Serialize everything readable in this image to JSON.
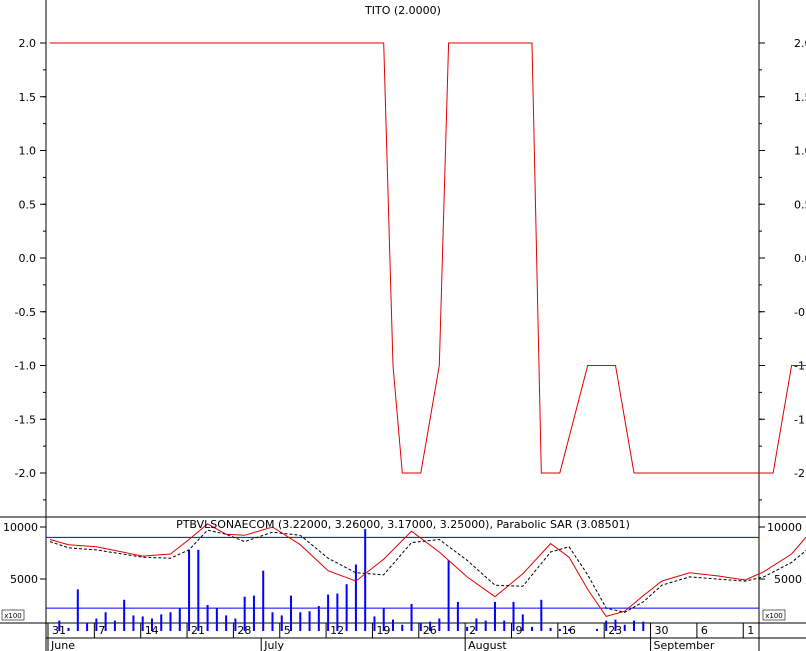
{
  "chart_data": [
    {
      "type": "line",
      "title": "TITO (2.0000)",
      "ylim": [
        -2.5,
        2.25
      ],
      "yticks": [
        "2.0",
        "1.5",
        "1.0",
        "0.5",
        "0.0",
        "-0.5",
        "-1.0",
        "-1.5",
        "-2.0"
      ],
      "ytick_values": [
        2.0,
        1.5,
        1.0,
        0.5,
        0.0,
        -0.5,
        -1.0,
        -1.5,
        -2.0
      ],
      "series": [
        {
          "color": "#e00000",
          "x": [
            0,
            36,
            37,
            38,
            40,
            42,
            43,
            45,
            52,
            53,
            55,
            58,
            60,
            61,
            63,
            65,
            78,
            80,
            80.5,
            82.5,
            83,
            85,
            86,
            87
          ],
          "values": [
            2.0,
            2.0,
            -1.0,
            -2.0,
            -2.0,
            -1.0,
            2.0,
            2.0,
            2.0,
            -2.0,
            -2.0,
            -1.0,
            -1.0,
            -1.0,
            -2.0,
            -2.0,
            -2.0,
            -1.0,
            -1.0,
            -1.0,
            2.0,
            2.0,
            2.0,
            2.0
          ]
        }
      ]
    },
    {
      "type": "bar",
      "title": "PTBVLSONAECOM (3.22000, 3.26000, 3.17000, 3.25000), Parabolic SAR (3.08501)",
      "ylim": [
        0,
        11000
      ],
      "yticks": [
        "10000",
        "5000"
      ],
      "ytick_values": [
        10000,
        5000
      ],
      "y_multiplier_label": "x100",
      "hlines": [
        9000,
        2200
      ],
      "volume": [
        [
          1,
          1000
        ],
        [
          2,
          300
        ],
        [
          3,
          4000
        ],
        [
          4,
          800
        ],
        [
          5,
          1200
        ],
        [
          6,
          1800
        ],
        [
          7,
          1000
        ],
        [
          8,
          3000
        ],
        [
          9,
          1500
        ],
        [
          10,
          1400
        ],
        [
          11,
          1200
        ],
        [
          12,
          1600
        ],
        [
          13,
          1800
        ],
        [
          14,
          2200
        ],
        [
          15,
          7800
        ],
        [
          16,
          7800
        ],
        [
          17,
          2500
        ],
        [
          18,
          2200
        ],
        [
          19,
          1500
        ],
        [
          20,
          1200
        ],
        [
          21,
          3300
        ],
        [
          22,
          3400
        ],
        [
          23,
          5800
        ],
        [
          24,
          1800
        ],
        [
          25,
          1500
        ],
        [
          26,
          3400
        ],
        [
          27,
          1800
        ],
        [
          28,
          1900
        ],
        [
          29,
          2400
        ],
        [
          30,
          3500
        ],
        [
          31,
          3600
        ],
        [
          32,
          4500
        ],
        [
          33,
          6400
        ],
        [
          34,
          9800
        ],
        [
          35,
          1400
        ],
        [
          36,
          2200
        ],
        [
          37,
          1100
        ],
        [
          38,
          600
        ],
        [
          39,
          2600
        ],
        [
          40,
          800
        ],
        [
          41,
          900
        ],
        [
          42,
          1200
        ],
        [
          43,
          6800
        ],
        [
          44,
          2800
        ],
        [
          45,
          400
        ],
        [
          46,
          1200
        ],
        [
          47,
          1000
        ],
        [
          48,
          2800
        ],
        [
          49,
          1000
        ],
        [
          50,
          2800
        ],
        [
          51,
          1600
        ],
        [
          52,
          400
        ],
        [
          53,
          3000
        ],
        [
          54,
          300
        ],
        [
          55,
          200
        ],
        [
          56,
          200
        ],
        [
          57,
          0
        ],
        [
          58,
          0
        ],
        [
          59,
          200
        ],
        [
          60,
          1000
        ],
        [
          61,
          1100
        ],
        [
          62,
          600
        ],
        [
          63,
          1000
        ],
        [
          64,
          900
        ]
      ],
      "price": [
        [
          0,
          8800
        ],
        [
          2,
          8300
        ],
        [
          5,
          8100
        ],
        [
          10,
          7200
        ],
        [
          13,
          7400
        ],
        [
          15,
          8800
        ],
        [
          17,
          10300
        ],
        [
          19,
          9300
        ],
        [
          21,
          9200
        ],
        [
          24,
          10000
        ],
        [
          27,
          8300
        ],
        [
          30,
          5800
        ],
        [
          33,
          4800
        ],
        [
          36,
          6900
        ],
        [
          39,
          9600
        ],
        [
          42,
          7600
        ],
        [
          45,
          5200
        ],
        [
          48,
          3300
        ],
        [
          51,
          5500
        ],
        [
          54,
          8400
        ],
        [
          56,
          7100
        ],
        [
          58,
          4000
        ],
        [
          60,
          1400
        ],
        [
          62,
          1900
        ],
        [
          64,
          3400
        ],
        [
          66,
          4800
        ],
        [
          69,
          5600
        ],
        [
          72,
          5300
        ],
        [
          75,
          4900
        ],
        [
          77,
          5700
        ],
        [
          80,
          7400
        ],
        [
          83,
          10500
        ],
        [
          84,
          10700
        ]
      ],
      "sar": [
        [
          0,
          8600
        ],
        [
          2,
          8000
        ],
        [
          5,
          7800
        ],
        [
          10,
          7100
        ],
        [
          13,
          7000
        ],
        [
          15,
          7800
        ],
        [
          17,
          9700
        ],
        [
          19,
          9300
        ],
        [
          21,
          8600
        ],
        [
          24,
          9500
        ],
        [
          27,
          9200
        ],
        [
          30,
          7000
        ],
        [
          33,
          5600
        ],
        [
          36,
          5400
        ],
        [
          39,
          8500
        ],
        [
          42,
          8800
        ],
        [
          45,
          6800
        ],
        [
          48,
          4400
        ],
        [
          51,
          4300
        ],
        [
          54,
          7600
        ],
        [
          56,
          8100
        ],
        [
          58,
          5400
        ],
        [
          60,
          2200
        ],
        [
          62,
          1800
        ],
        [
          64,
          2800
        ],
        [
          66,
          4400
        ],
        [
          69,
          5200
        ],
        [
          72,
          5000
        ],
        [
          75,
          4800
        ],
        [
          77,
          5200
        ],
        [
          80,
          6600
        ],
        [
          83,
          8800
        ],
        [
          84,
          9500
        ]
      ]
    }
  ],
  "x_axis": {
    "day_ticks": [
      {
        "x": 0,
        "label": "31"
      },
      {
        "x": 5,
        "label": "7"
      },
      {
        "x": 10,
        "label": "14"
      },
      {
        "x": 15,
        "label": "21"
      },
      {
        "x": 20,
        "label": "28"
      },
      {
        "x": 25,
        "label": "5"
      },
      {
        "x": 30,
        "label": "12"
      },
      {
        "x": 35,
        "label": "19"
      },
      {
        "x": 40,
        "label": "26"
      },
      {
        "x": 45,
        "label": "2"
      },
      {
        "x": 50,
        "label": "9"
      },
      {
        "x": 55,
        "label": "16"
      },
      {
        "x": 60,
        "label": "23"
      },
      {
        "x": 65,
        "label": "30"
      },
      {
        "x": 70,
        "label": "6"
      },
      {
        "x": 75,
        "label": "1"
      }
    ],
    "months": [
      {
        "x": 0,
        "label": "June"
      },
      {
        "x": 23,
        "label": "July"
      },
      {
        "x": 45,
        "label": "August"
      },
      {
        "x": 65,
        "label": "September"
      }
    ]
  },
  "colors": {
    "line": "#e00000",
    "volume": "#0000ff",
    "hline": "#0000ff",
    "sar": "#000000",
    "axis": "#000000"
  }
}
